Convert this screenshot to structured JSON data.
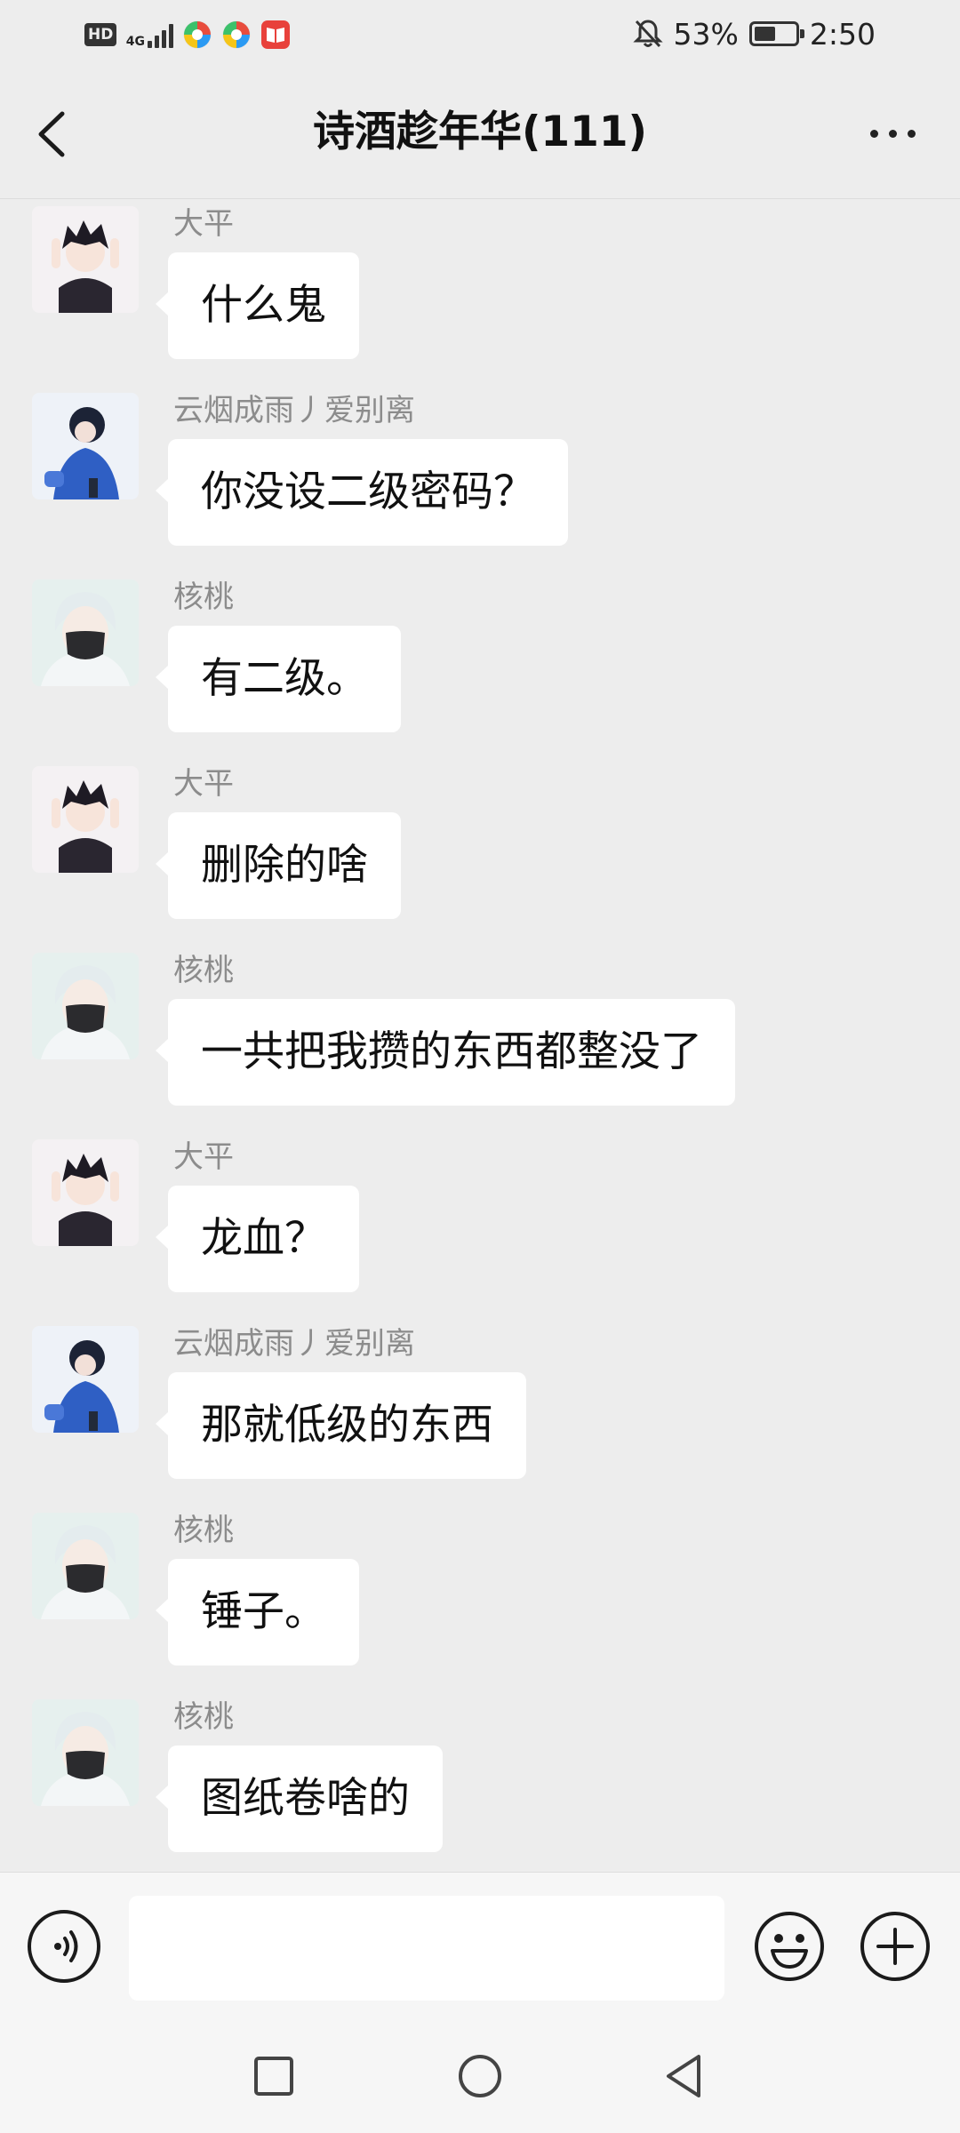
{
  "status_bar": {
    "hd_label": "HD",
    "network_label": "4G",
    "battery_percent": "53%",
    "battery_level": 0.53,
    "time": "2:50"
  },
  "nav": {
    "title": "诗酒趁年华(111)"
  },
  "messages": [
    {
      "sender": "大平",
      "text": "什么鬼",
      "avatar": "avatar-dark-hair-boy"
    },
    {
      "sender": "云烟成雨丿爱别离",
      "text": "你没设二级密码？",
      "avatar": "avatar-blue-hoodie"
    },
    {
      "sender": "核桃",
      "text": "有二级。",
      "avatar": "avatar-white-hair-mask"
    },
    {
      "sender": "大平",
      "text": "删除的啥",
      "avatar": "avatar-dark-hair-boy"
    },
    {
      "sender": "核桃",
      "text": "一共把我攒的东西都整没了",
      "avatar": "avatar-white-hair-mask"
    },
    {
      "sender": "大平",
      "text": "龙血？",
      "avatar": "avatar-dark-hair-boy"
    },
    {
      "sender": "云烟成雨丿爱别离",
      "text": "那就低级的东西",
      "avatar": "avatar-blue-hoodie"
    },
    {
      "sender": "核桃",
      "text": "锤子。",
      "avatar": "avatar-white-hair-mask"
    },
    {
      "sender": "核桃",
      "text": "图纸卷啥的",
      "avatar": "avatar-white-hair-mask"
    }
  ],
  "input": {
    "value": "",
    "placeholder": ""
  },
  "colors": {
    "background": "#ededed",
    "bubble": "#ffffff",
    "sender_name": "#8c8c8c",
    "input_bar": "#f6f6f6"
  },
  "icons": {
    "back": "chevron-left-icon",
    "more": "more-dots-icon",
    "voice": "voice-icon",
    "emoji": "emoji-icon",
    "plus": "plus-icon",
    "recent": "square-icon",
    "home": "circle-icon",
    "back_sys": "triangle-back-icon"
  }
}
